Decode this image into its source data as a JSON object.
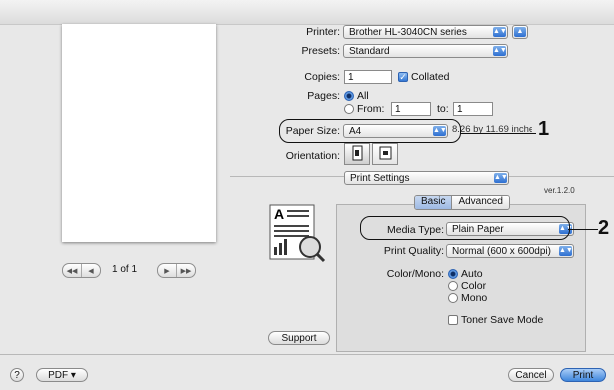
{
  "printer": {
    "label": "Printer:",
    "value": "Brother HL-3040CN series"
  },
  "presets": {
    "label": "Presets:",
    "value": "Standard"
  },
  "copies": {
    "label": "Copies:",
    "value": "1",
    "collated_label": "Collated",
    "collated": true
  },
  "pages": {
    "label": "Pages:",
    "all_label": "All",
    "from_label": "From:",
    "from_value": "1",
    "to_label": "to:",
    "to_value": "1"
  },
  "paper_size": {
    "label": "Paper Size:",
    "value": "A4",
    "dims": "8.26 by 11.69 inches"
  },
  "orientation": {
    "label": "Orientation:"
  },
  "section": {
    "value": "Print Settings",
    "version": "ver.1.2.0"
  },
  "tabs": [
    {
      "label": "Basic"
    },
    {
      "label": "Advanced"
    }
  ],
  "media_type": {
    "label": "Media Type:",
    "value": "Plain Paper"
  },
  "print_quality": {
    "label": "Print Quality:",
    "value": "Normal (600 x 600dpi)"
  },
  "color_mono": {
    "label": "Color/Mono:",
    "options": [
      "Auto",
      "Color",
      "Mono"
    ],
    "selected": "Auto"
  },
  "toner_save": {
    "label": "Toner Save Mode"
  },
  "support_button": "Support",
  "preview": {
    "page_indicator": "1 of 1"
  },
  "footer": {
    "help": "?",
    "pdf": "PDF ▾",
    "cancel": "Cancel",
    "print": "Print"
  },
  "callouts": [
    "1",
    "2"
  ],
  "colors": {
    "accent": "#3f86dc"
  }
}
